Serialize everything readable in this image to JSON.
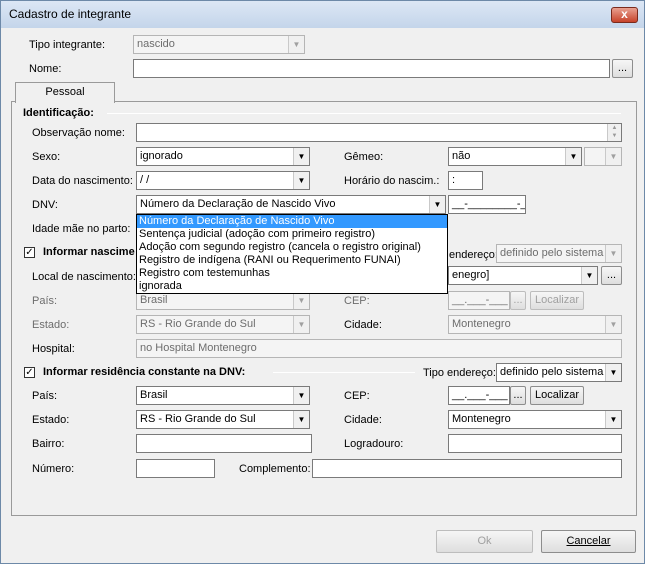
{
  "window": {
    "title": "Cadastro de integrante",
    "close_glyph": "x"
  },
  "top": {
    "tipo_integrante_label": "Tipo integrante:",
    "tipo_integrante_value": "nascido",
    "nome_label": "Nome:",
    "nome_value": "",
    "ellipsis": "..."
  },
  "tabs": [
    {
      "label": "Pessoal"
    }
  ],
  "identificacao": {
    "section_title": "Identificação:",
    "observacao_label": "Observação nome:",
    "observacao_value": "",
    "sexo_label": "Sexo:",
    "sexo_value": "ignorado",
    "gemeo_label": "Gêmeo:",
    "gemeo_value": "não",
    "gemeo_extra_value": "",
    "data_nasc_label": "Data do nascimento:",
    "data_nasc_value": " / /",
    "horario_label": "Horário do nascim.:",
    "horario_value": ":",
    "dnv_label": "DNV:",
    "dnv_value": "Número da Declaração de Nascido Vivo",
    "dnv_number_value": "__-________-_",
    "idade_mae_label": "Idade mãe no parto:"
  },
  "dnv_dropdown": {
    "options": [
      "Número da Declaração de Nascido Vivo",
      "Sentença judicial (adoção com primeiro registro)",
      "Adoção com segundo registro (cancela o registro original)",
      "Registro de indígena (RANI ou Requerimento FUNAI)",
      "Registro com testemunhas",
      "ignorada"
    ],
    "selected_index": 0
  },
  "nascimento": {
    "checkbox_label": "Informar nascime",
    "checked": true,
    "tipo_endereco_label": "endereço:",
    "tipo_endereco_value": "definido pelo sistema",
    "local_label": "Local de nascimento:",
    "local_value": "enegro]",
    "pais_label": "País:",
    "pais_value": "Brasil",
    "cep_label": "CEP:",
    "cep_value": "__.___-___",
    "localizar_label": "Localizar",
    "estado_label": "Estado:",
    "estado_value": "RS - Rio Grande do Sul",
    "cidade_label": "Cidade:",
    "cidade_value": "Montenegro",
    "hospital_label": "Hospital:",
    "hospital_value": "no Hospital Montenegro"
  },
  "residencia": {
    "checkbox_label": "Informar residência constante na DNV:",
    "checked": true,
    "tipo_endereco_label": "Tipo endereço:",
    "tipo_endereco_value": "definido pelo sistema",
    "pais_label": "País:",
    "pais_value": "Brasil",
    "cep_label": "CEP:",
    "cep_value": "__.___-___",
    "localizar_label": "Localizar",
    "estado_label": "Estado:",
    "estado_value": "RS - Rio Grande do Sul",
    "cidade_label": "Cidade:",
    "cidade_value": "Montenegro",
    "bairro_label": "Bairro:",
    "bairro_value": "",
    "logradouro_label": "Logradouro:",
    "logradouro_value": "",
    "numero_label": "Número:",
    "numero_value": "",
    "complemento_label": "Complemento:",
    "complemento_value": ""
  },
  "footer": {
    "ok_label": "Ok",
    "cancel_label": "Cancelar"
  },
  "glyphs": {
    "dropdown_arrow": "▼",
    "check": "✓",
    "up": "▲",
    "down": "▼"
  }
}
